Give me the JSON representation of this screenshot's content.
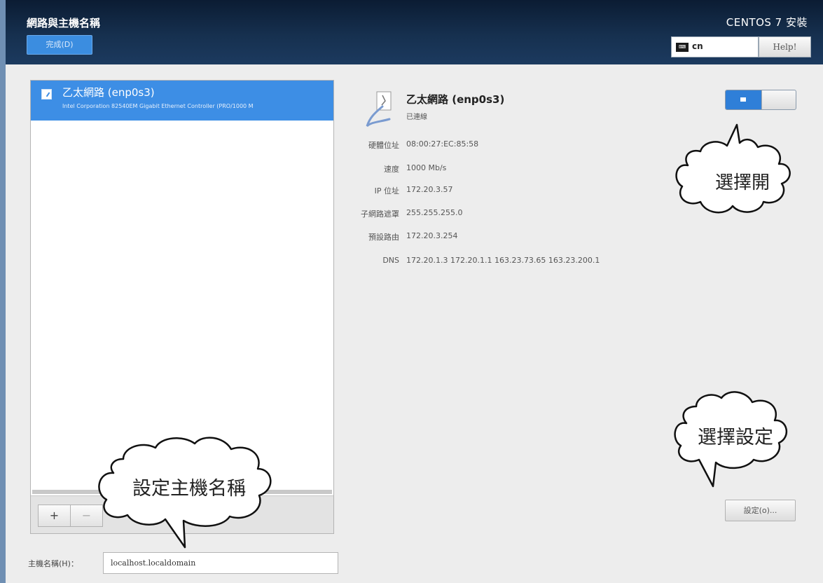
{
  "header": {
    "title": "網路與主機名稱",
    "done_label": "完成(D)",
    "install_title": "CENTOS 7 安裝",
    "keyboard_layout": "cn",
    "keyboard_icon_text": "⌨",
    "help_label": "Help!"
  },
  "device_list": {
    "items": [
      {
        "name": "乙太網路 (enp0s3)",
        "description": "Intel Corporation 82540EM Gigabit Ethernet Controller (PRO/1000 M"
      }
    ],
    "add_label": "+",
    "remove_label": "−"
  },
  "hostname": {
    "label": "主機名稱(H)：",
    "value": "localhost.localdomain"
  },
  "detail": {
    "title": "乙太網路 (enp0s3)",
    "status": "已連線",
    "properties": [
      {
        "label": "硬體位址",
        "value": "08:00:27:EC:85:58"
      },
      {
        "label": "速度",
        "value": "1000 Mb/s"
      },
      {
        "label": "IP 位址",
        "value": "172.20.3.57"
      },
      {
        "label": "子網路遮罩",
        "value": "255.255.255.0"
      },
      {
        "label": "預設路由",
        "value": "172.20.3.254"
      },
      {
        "label": "DNS",
        "value": "172.20.1.3 172.20.1.1 163.23.73.65 163.23.200.1"
      }
    ],
    "toggle_on": true,
    "configure_label": "設定(o)..."
  },
  "callouts": {
    "toggle": "選擇開",
    "configure": "選擇設定",
    "hostname": "設定主機名稱"
  },
  "colors": {
    "accent": "#3d8ee5",
    "header_bg": "#0b1c33"
  }
}
